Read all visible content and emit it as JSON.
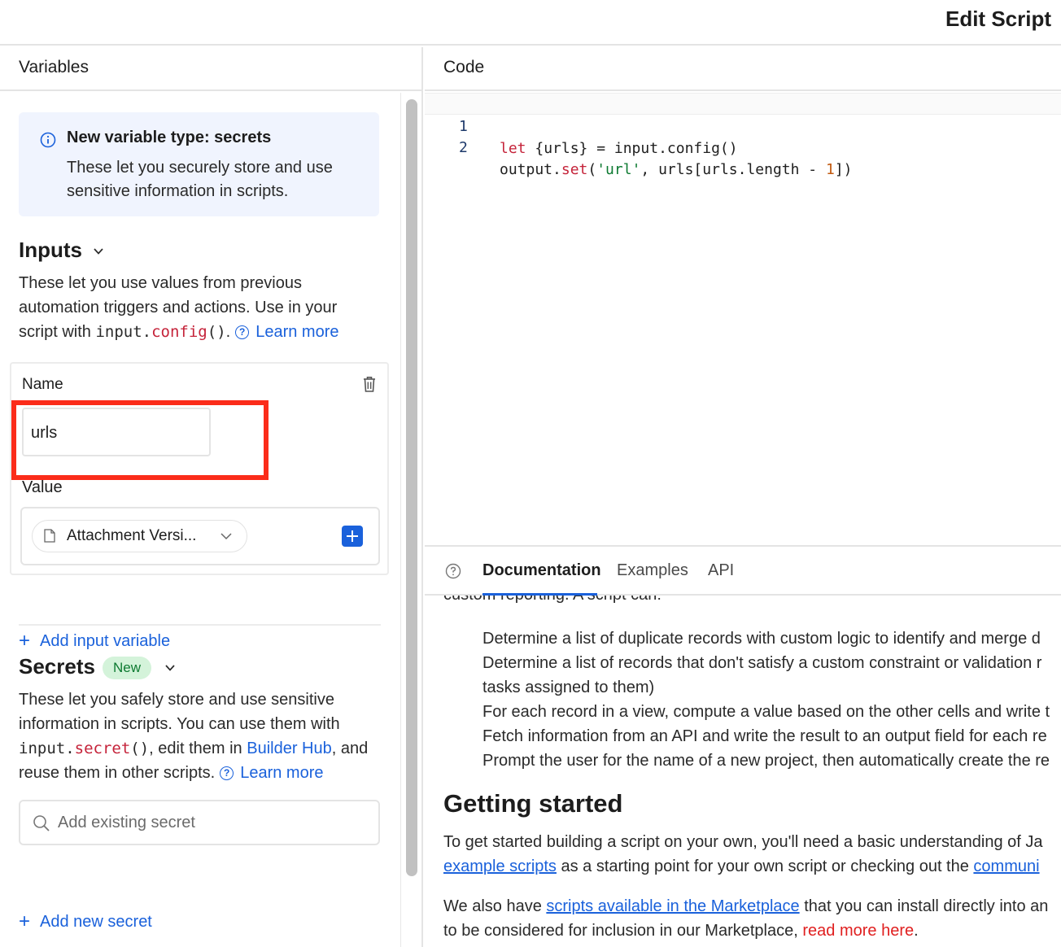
{
  "topbar": {
    "title": "Edit Script"
  },
  "left": {
    "header": "Variables",
    "notice": {
      "title": "New variable type: secrets",
      "body": "These let you securely store and use sensitive information in scripts."
    },
    "inputs": {
      "title": "Inputs",
      "desc_1": "These let you use values from previous automation triggers and actions. Use in your script with ",
      "code_obj": "input.",
      "code_fn": "config",
      "code_paren": "()",
      "desc_end": ".",
      "learn_more": "Learn more",
      "variable": {
        "name_label": "Name",
        "name_value": "urls",
        "value_label": "Value",
        "value_selected": "Attachment Versi..."
      },
      "add_label": "Add input variable"
    },
    "secrets": {
      "title": "Secrets",
      "badge": "New",
      "desc_1": "These let you safely store and use sensitive information in scripts. You can use them with ",
      "code_obj": "input.",
      "code_fn": "secret",
      "code_paren": "()",
      "desc_2": ", edit them in ",
      "builder_hub": "Builder Hub",
      "desc_3": ", and reuse them in other scripts.",
      "learn_more": "Learn more",
      "search_placeholder": "Add existing secret",
      "add_label": "Add new secret"
    }
  },
  "right": {
    "header": "Code",
    "code_lines": [
      {
        "num": "1",
        "kw": "let",
        "rest": " {urls} = input.config()"
      },
      {
        "num": "2",
        "obj": "output.",
        "fn": "set",
        "open": "(",
        "str": "'url'",
        "mid": ", urls[urls.length - ",
        "n": "1",
        "close": "])"
      }
    ],
    "doc_tabs": [
      "Documentation",
      "Examples",
      "API"
    ],
    "doc": {
      "cut_text": "custom reporting. A script can:",
      "list": [
        "Determine a list of duplicate records with custom logic to identify and merge d",
        "Determine a list of records that don't satisfy a custom constraint or validation r",
        "tasks assigned to them)",
        "For each record in a view, compute a value based on the other cells and write t",
        "Fetch information from an API and write the result to an output field for each re",
        "Prompt the user for the name of a new project, then automatically create the re"
      ],
      "heading": "Getting started",
      "p1_line1": "To get started building a script on your own, you'll need a basic understanding of Ja",
      "p1_link1": "example scripts",
      "p1_mid": " as a starting point for your own script or checking out the ",
      "p1_link2": "communi",
      "p2_a": "We also have ",
      "p2_link": "scripts available in the Marketplace",
      "p2_b": " that you can install directly into an",
      "p2_c": "to be considered for inclusion in our Marketplace, ",
      "p2_red": "read more here",
      "p2_end": "."
    }
  },
  "colors": {
    "accent": "#1a61db",
    "highlight": "#fb2c1a",
    "badge_bg": "#d4f3da",
    "notice_bg": "#f0f4fe"
  }
}
